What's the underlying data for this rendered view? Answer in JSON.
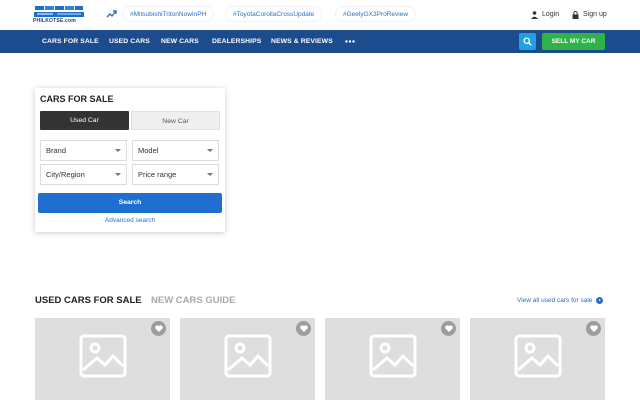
{
  "header": {
    "logo_text": "PHILKOTSE.com",
    "hashtags": [
      "#MitsubishiTritonNowInPH",
      "#ToyotaCorollaCrossUpdate",
      "#GeelyGX3ProReview"
    ],
    "login_label": "Login",
    "signup_label": "Sign up"
  },
  "nav": {
    "items": [
      "CARS FOR SALE",
      "USED CARS",
      "NEW CARS",
      "DEALERSHIPS",
      "NEWS & REVIEWS"
    ],
    "sell_label": "SELL MY CAR"
  },
  "search_card": {
    "title": "CARS FOR SALE",
    "tab_used": "Used Car",
    "tab_new": "New Car",
    "brand": "Brand",
    "model": "Model",
    "city": "City/Region",
    "price": "Price range",
    "search_label": "Search",
    "advanced_label": "Advanced search"
  },
  "section": {
    "active_tab": "USED CARS FOR SALE",
    "inactive_tab": "NEW CARS GUIDE",
    "view_all": "View all used cars for sale"
  },
  "colors": {
    "nav_bg": "#1d4c8e",
    "sell_btn": "#2db34a",
    "search_btn": "#1e6fcf",
    "link": "#2c6fc2"
  }
}
